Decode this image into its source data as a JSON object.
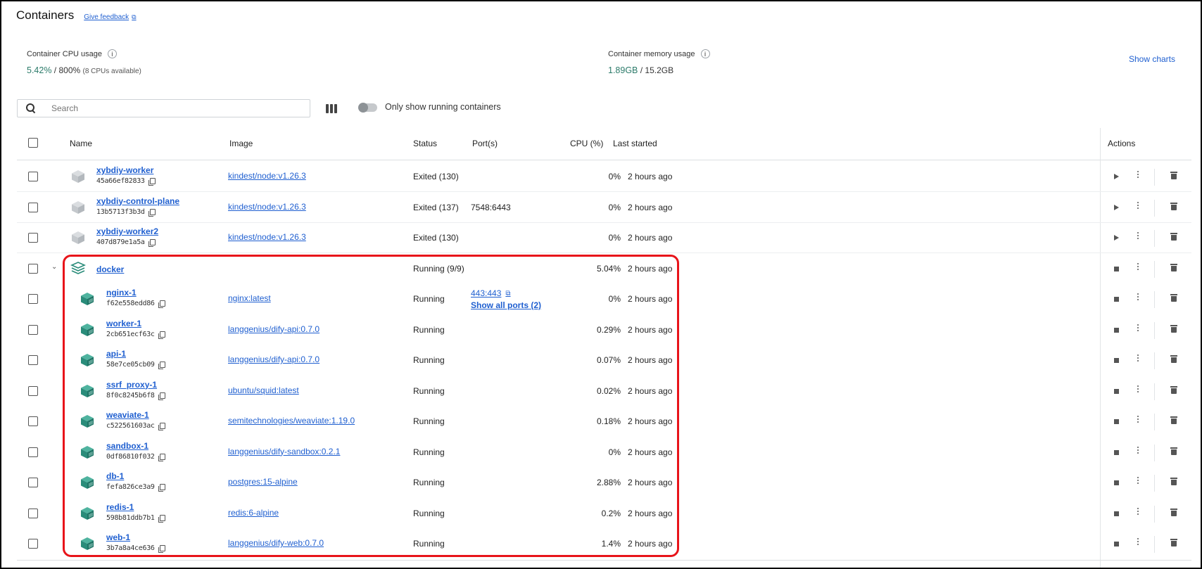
{
  "header": {
    "title": "Containers",
    "feedback": "Give feedback",
    "feedback_icon": "external-link-icon"
  },
  "metrics": {
    "cpu": {
      "label": "Container CPU usage",
      "value": "5.42%",
      "total": "/ 800%",
      "note": "(8 CPUs available)"
    },
    "memory": {
      "label": "Container memory usage",
      "value": "1.89GB",
      "total": "/ 15.2GB"
    },
    "show_charts": "Show charts"
  },
  "search": {
    "placeholder": "Search",
    "value": ""
  },
  "filter": {
    "toggle_label": "Only show running containers",
    "toggle_on": false
  },
  "table": {
    "headers": {
      "name": "Name",
      "image": "Image",
      "status": "Status",
      "ports": "Port(s)",
      "cpu": "CPU (%)",
      "last_started": "Last started",
      "actions": "Actions"
    },
    "rows": [
      {
        "name": "xybdiy-worker",
        "id": "45a66ef82833",
        "image": "kindest/node:v1.26.3",
        "status": "Exited (130)",
        "ports": "",
        "cpu": "0%",
        "last": "2 hours ago",
        "state": "exited"
      },
      {
        "name": "xybdiy-control-plane",
        "id": "13b5713f3b3d",
        "image": "kindest/node:v1.26.3",
        "status": "Exited (137)",
        "ports": "7548:6443",
        "cpu": "0%",
        "last": "2 hours ago",
        "state": "exited"
      },
      {
        "name": "xybdiy-worker2",
        "id": "407d879e1a5a",
        "image": "kindest/node:v1.26.3",
        "status": "Exited (130)",
        "ports": "",
        "cpu": "0%",
        "last": "2 hours ago",
        "state": "exited"
      }
    ],
    "group": {
      "name": "docker",
      "status": "Running (9/9)",
      "cpu": "5.04%",
      "last": "2 hours ago"
    },
    "group_rows": [
      {
        "name": "nginx-1",
        "id": "f62e558edd86",
        "image": "nginx:latest",
        "status": "Running",
        "port_main": "443:443",
        "port_more": "Show all ports (2)",
        "cpu": "0%",
        "last": "2 hours ago"
      },
      {
        "name": "worker-1",
        "id": "2cb651ecf63c",
        "image": "langgenius/dify-api:0.7.0",
        "status": "Running",
        "cpu": "0.29%",
        "last": "2 hours ago"
      },
      {
        "name": "api-1",
        "id": "58e7ce05cb09",
        "image": "langgenius/dify-api:0.7.0",
        "status": "Running",
        "cpu": "0.07%",
        "last": "2 hours ago"
      },
      {
        "name": "ssrf_proxy-1",
        "id": "8f0c8245b6f8",
        "image": "ubuntu/squid:latest",
        "status": "Running",
        "cpu": "0.02%",
        "last": "2 hours ago"
      },
      {
        "name": "weaviate-1",
        "id": "c522561603ac",
        "image": "semitechnologies/weaviate:1.19.0",
        "status": "Running",
        "cpu": "0.18%",
        "last": "2 hours ago"
      },
      {
        "name": "sandbox-1",
        "id": "0df86810f032",
        "image": "langgenius/dify-sandbox:0.2.1",
        "status": "Running",
        "cpu": "0%",
        "last": "2 hours ago"
      },
      {
        "name": "db-1",
        "id": "fefa826ce3a9",
        "image": "postgres:15-alpine",
        "status": "Running",
        "cpu": "2.88%",
        "last": "2 hours ago"
      },
      {
        "name": "redis-1",
        "id": "598b81ddb7b1",
        "image": "redis:6-alpine",
        "status": "Running",
        "cpu": "0.2%",
        "last": "2 hours ago"
      },
      {
        "name": "web-1",
        "id": "3b7a8a4ce636",
        "image": "langgenius/dify-web:0.7.0",
        "status": "Running",
        "cpu": "1.4%",
        "last": "2 hours ago"
      }
    ]
  },
  "colors": {
    "accent": "#1f5fd0",
    "running_icon": "#2a8c7a",
    "exited_icon": "#c8ccd0",
    "highlight": "#e8141a",
    "metric_value": "#2c7b6a"
  }
}
